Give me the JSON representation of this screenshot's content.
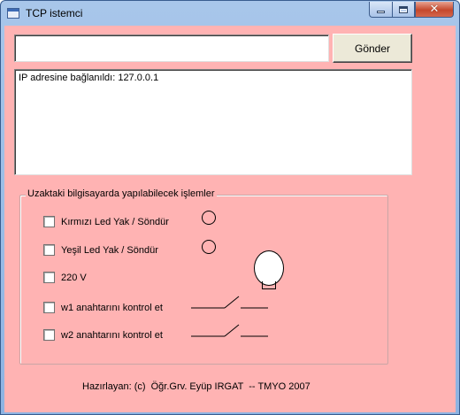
{
  "window": {
    "title": "TCP istemci",
    "icons": {
      "app": "form-icon",
      "minimize": "minimize-icon",
      "maximize": "maximize-icon",
      "close": "close-icon"
    },
    "close_glyph": "✕"
  },
  "input": {
    "value": "",
    "placeholder": ""
  },
  "send_button": {
    "label": "Gönder"
  },
  "log": {
    "text": "IP adresine bağlanıldı: 127.0.0.1"
  },
  "group": {
    "title": "Uzaktaki bilgisayarda yapılabilecek işlemler",
    "options": [
      {
        "label": "Kırmızı Led Yak / Söndür",
        "checked": false
      },
      {
        "label": "Yeşil Led Yak / Söndür",
        "checked": false
      },
      {
        "label": "220 V",
        "checked": false
      },
      {
        "label": "w1 anahtarını kontrol et",
        "checked": false
      },
      {
        "label": "w2 anahtarını kontrol et",
        "checked": false
      }
    ]
  },
  "footer": {
    "text": "Hazırlayan: (c)  Öğr.Grv. Eyüp IRGAT  -- TMYO 2007"
  },
  "colors": {
    "form_background": "#ffb3b3",
    "button_face": "#ece9d8"
  }
}
